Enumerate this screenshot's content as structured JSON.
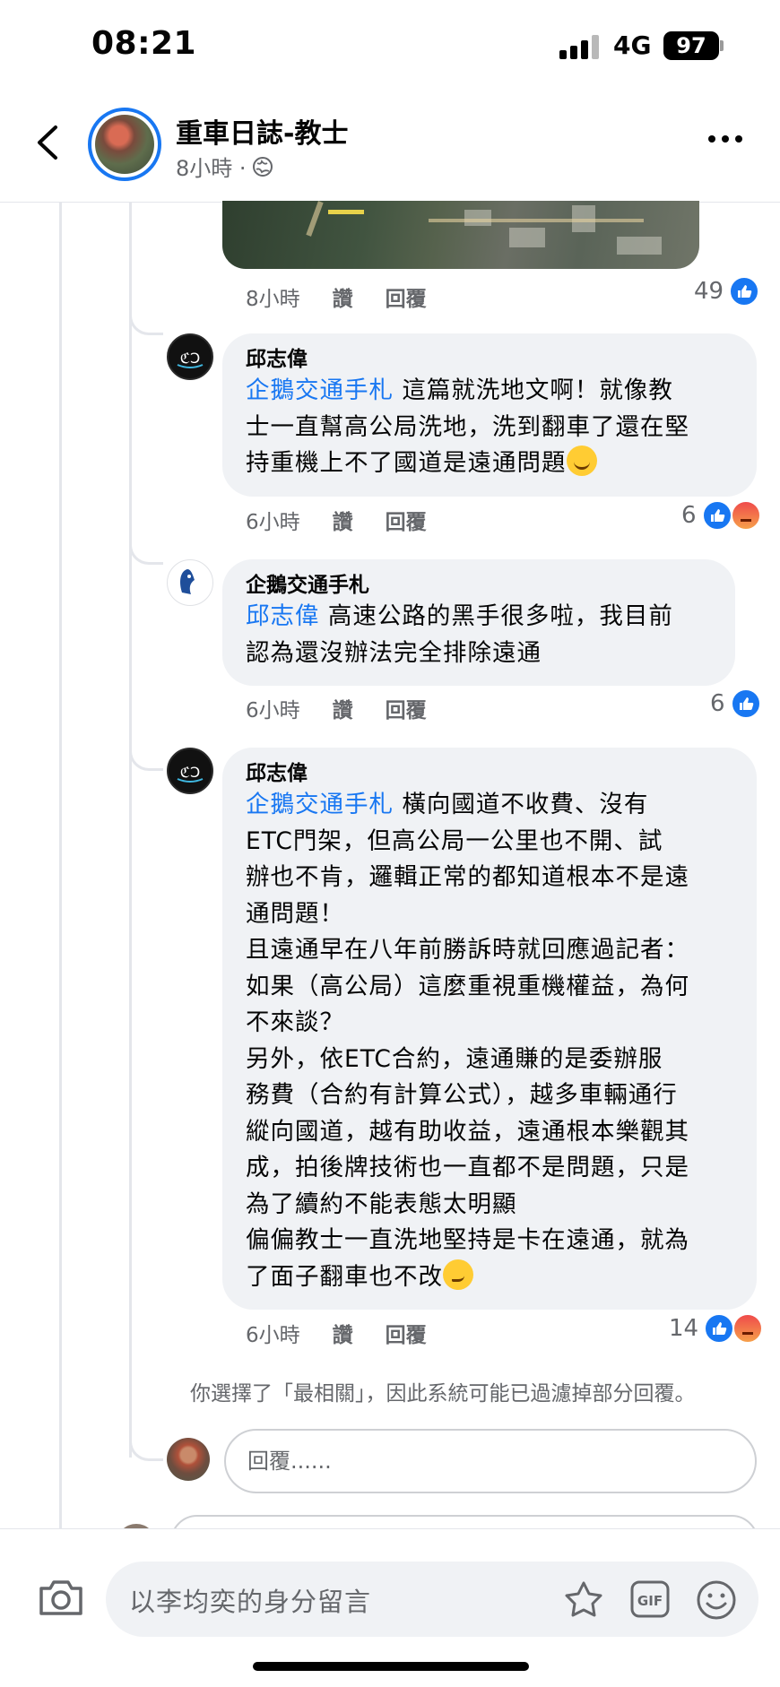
{
  "status_bar": {
    "time": "08:21",
    "network": "4G",
    "battery": "97"
  },
  "header": {
    "title": "重車日誌-教士",
    "time_ago": "8小時 ·"
  },
  "map_comment": {
    "time": "8小時",
    "like_label": "讚",
    "reply_label": "回覆",
    "reaction_count": "49"
  },
  "comments": [
    {
      "name": "邱志偉",
      "mention": "企鵝交通手札",
      "text": " 這篇就洗地文啊！就像教\n士一直幫高公局洗地，洗到翻車了還在堅\n持重機上不了國道是遠通問題",
      "emoji": "grinning-squint-emoji",
      "time": "6小時",
      "like_label": "讚",
      "reply_label": "回覆",
      "reaction_count": "6",
      "reactions": [
        "like",
        "angry"
      ]
    },
    {
      "name": "企鵝交通手札",
      "mention": "邱志偉",
      "text": " 高速公路的黑手很多啦，我目前\n認為還沒辦法完全排除遠通",
      "time": "6小時",
      "like_label": "讚",
      "reply_label": "回覆",
      "reaction_count": "6",
      "reactions": [
        "like"
      ]
    },
    {
      "name": "邱志偉",
      "mention": "企鵝交通手札",
      "text": " 橫向國道不收費、沒有\nETC門架，但高公局一公里也不開、試\n辦也不肯，邏輯正常的都知道根本不是遠\n通問題！\n且遠通早在八年前勝訴時就回應過記者：\n如果（高公局）這麼重視重機權益，為何\n不來談？\n另外，依ETC合約，遠通賺的是委辦服\n務費（合約有計算公式），越多車輛通行\n縱向國道，越有助收益，遠通根本樂觀其\n成，拍後牌技術也一直都不是問題，只是\n為了續約不能表態太明顯\n偏偏教士一直洗地堅持是卡在遠通，就為\n了面子翻車也不改",
      "emoji": "smirk-emoji",
      "time": "6小時",
      "like_label": "讚",
      "reply_label": "回覆",
      "reaction_count": "14",
      "reactions": [
        "like",
        "angry"
      ]
    }
  ],
  "filter_note": "你選擇了「最相關」，因此系統可能已過濾掉部分回覆。",
  "reply_box": {
    "placeholder": "回覆......"
  },
  "composer": {
    "placeholder": "以李均奕的身分留言"
  },
  "colors": {
    "accent": "#1877f2",
    "bubble": "#f0f2f5",
    "muted": "#65676b"
  }
}
